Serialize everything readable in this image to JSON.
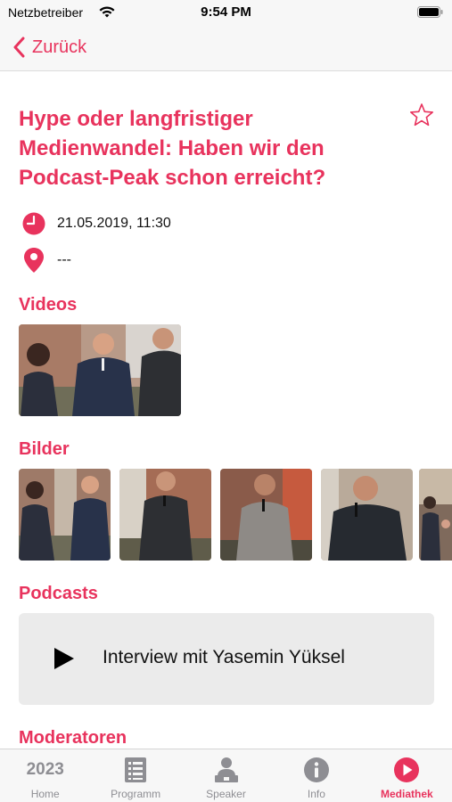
{
  "status_bar": {
    "carrier": "Netzbetreiber",
    "time": "9:54 PM",
    "icons": [
      "wifi-icon",
      "battery-icon"
    ]
  },
  "nav": {
    "back_label": "Zurück",
    "back_icon": "chevron-left-icon"
  },
  "colors": {
    "accent": "#e8335d",
    "tab_inactive": "#8e8e93",
    "card_background": "#ebebeb"
  },
  "talk": {
    "title": "Hype oder langfristiger Medienwandel: Haben wir den Podcast-Peak schon erreicht?",
    "favorite_icon": "star-outline-icon",
    "datetime": "21.05.2019, 11:30",
    "datetime_icon": "clock-icon",
    "location": "---",
    "location_icon": "map-pin-icon"
  },
  "sections": {
    "videos": "Videos",
    "images": "Bilder",
    "podcasts": "Podcasts",
    "moderators": "Moderatoren"
  },
  "videos": [
    {
      "kind": "video-thumbnail",
      "people": 3
    }
  ],
  "images": [
    {
      "kind": "photo-thumbnail"
    },
    {
      "kind": "photo-thumbnail"
    },
    {
      "kind": "photo-thumbnail"
    },
    {
      "kind": "photo-thumbnail"
    },
    {
      "kind": "photo-thumbnail"
    }
  ],
  "podcasts": [
    {
      "label": "Interview mit Yasemin Yüksel",
      "icon": "play-icon"
    }
  ],
  "tabs": [
    {
      "label": "Home",
      "icon": "year-badge",
      "badge_text": "2023",
      "active": false
    },
    {
      "label": "Programm",
      "icon": "list-icon",
      "active": false
    },
    {
      "label": "Speaker",
      "icon": "speaker-icon",
      "active": false
    },
    {
      "label": "Info",
      "icon": "info-icon",
      "active": false
    },
    {
      "label": "Mediathek",
      "icon": "play-circle-icon",
      "active": true
    }
  ]
}
